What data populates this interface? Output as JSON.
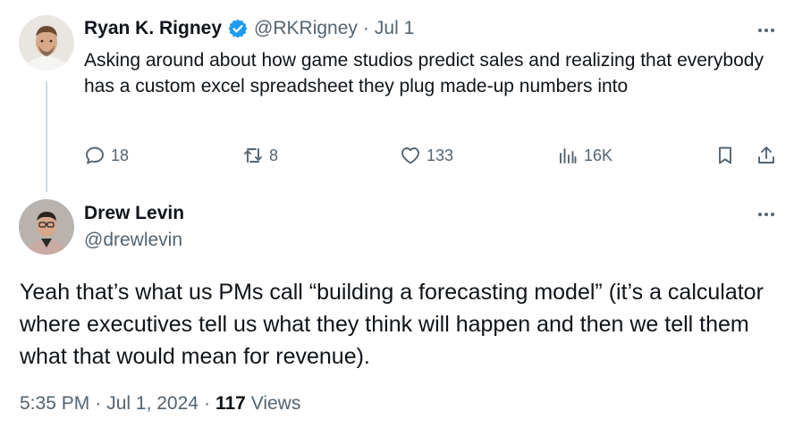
{
  "tweet1": {
    "name": "Ryan K. Rigney",
    "handle": "@RKRigney",
    "sep": "·",
    "date": "Jul 1",
    "text": "Asking around about how game studios predict sales and realizing that everybody has a custom excel spreadsheet they plug made-up numbers into",
    "verified": true,
    "actions": {
      "replies": "18",
      "reposts": "8",
      "likes": "133",
      "views": "16K"
    }
  },
  "tweet2": {
    "name": "Drew Levin",
    "handle": "@drewlevin",
    "text": "Yeah that’s what us PMs call “building a forecasting model” (it’s a calculator where executives tell us what they think will happen and then we tell them what that would mean for revenue).",
    "time": "5:35 PM",
    "sep1": "·",
    "date": "Jul 1, 2024",
    "sep2": "·",
    "views_count": "117",
    "views_label": "Views"
  },
  "colors": {
    "text": "#0f1419",
    "muted": "#536471",
    "verified": "#1d9bf0",
    "thread_line": "#cfd9de"
  },
  "icons": [
    "reply-icon",
    "repost-icon",
    "like-icon",
    "views-icon",
    "bookmark-icon",
    "share-icon",
    "more-icon",
    "verified-badge-icon"
  ]
}
